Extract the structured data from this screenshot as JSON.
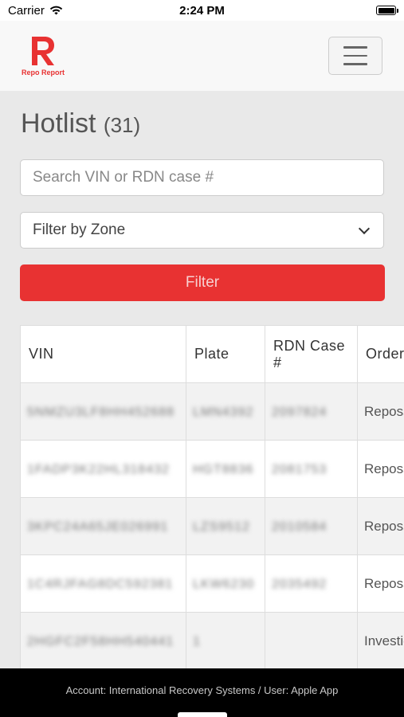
{
  "status_bar": {
    "carrier": "Carrier",
    "time": "2:24 PM"
  },
  "header": {
    "logo_text": "Repo Report",
    "brand_color": "#e83232"
  },
  "page": {
    "title": "Hotlist",
    "count": "(31)"
  },
  "search": {
    "placeholder": "Search VIN or RDN case #",
    "value": ""
  },
  "zone_filter": {
    "selected": "Filter by Zone"
  },
  "filter_button": {
    "label": "Filter"
  },
  "table": {
    "columns": [
      "VIN",
      "Plate",
      "RDN Case #",
      "Order Type"
    ],
    "rows": [
      {
        "vin": "5NMZU3LF8HH452688",
        "plate": "LMN4392",
        "rdn": "2097824",
        "order": "Repossession"
      },
      {
        "vin": "1FADP3K22HL318432",
        "plate": "HGT8836",
        "rdn": "2081753",
        "order": "Repossession"
      },
      {
        "vin": "3KPC24A65JE026991",
        "plate": "LZS9512",
        "rdn": "2010584",
        "order": "Repossession"
      },
      {
        "vin": "1C4RJFAG8DC592381",
        "plate": "LKW6230",
        "rdn": "2035492",
        "order": "Repossession"
      },
      {
        "vin": "2HGFC2F58HH540441",
        "plate": "1",
        "rdn": "",
        "order": "Investigation"
      }
    ]
  },
  "footer": {
    "text": "Account: International Recovery Systems / User: Apple App"
  }
}
